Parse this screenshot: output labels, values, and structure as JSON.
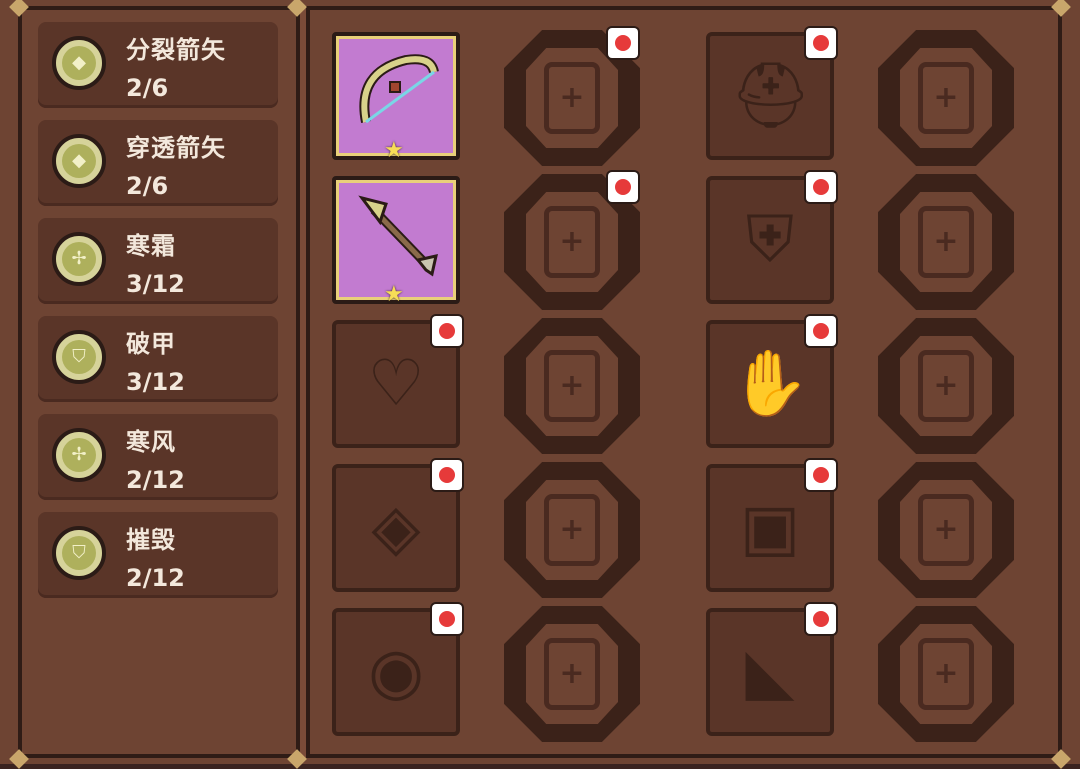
{
  "skills": [
    {
      "name": "分裂箭矢",
      "level": "2/6",
      "icon": "arrow-split-icon"
    },
    {
      "name": "穿透箭矢",
      "level": "2/6",
      "icon": "arrow-pierce-icon"
    },
    {
      "name": "寒霜",
      "level": "3/12",
      "icon": "frost-icon"
    },
    {
      "name": "破甲",
      "level": "3/12",
      "icon": "armor-break-icon"
    },
    {
      "name": "寒风",
      "level": "2/12",
      "icon": "cold-wind-icon"
    },
    {
      "name": "摧毁",
      "level": "2/12",
      "icon": "destroy-icon"
    }
  ],
  "equipment_rows": [
    {
      "weapon": "bow-icon",
      "weapon_equipped": true,
      "armor": "helmet-icon"
    },
    {
      "weapon": "arrow-icon",
      "weapon_equipped": true,
      "armor": "armor-chest-icon"
    },
    {
      "weapon": "necklace-icon",
      "weapon_equipped": false,
      "armor": "gloves-icon"
    },
    {
      "weapon": "amulet-icon",
      "weapon_equipped": false,
      "armor": "belt-icon"
    },
    {
      "weapon": "ring-icon",
      "weapon_equipped": false,
      "armor": "boots-icon"
    }
  ],
  "colors": {
    "panel": "#6e4433",
    "dark": "#3b2219",
    "equipped_bg": "#c27bd0",
    "notification": "#e63a3a",
    "text": "#f3e8dc"
  }
}
